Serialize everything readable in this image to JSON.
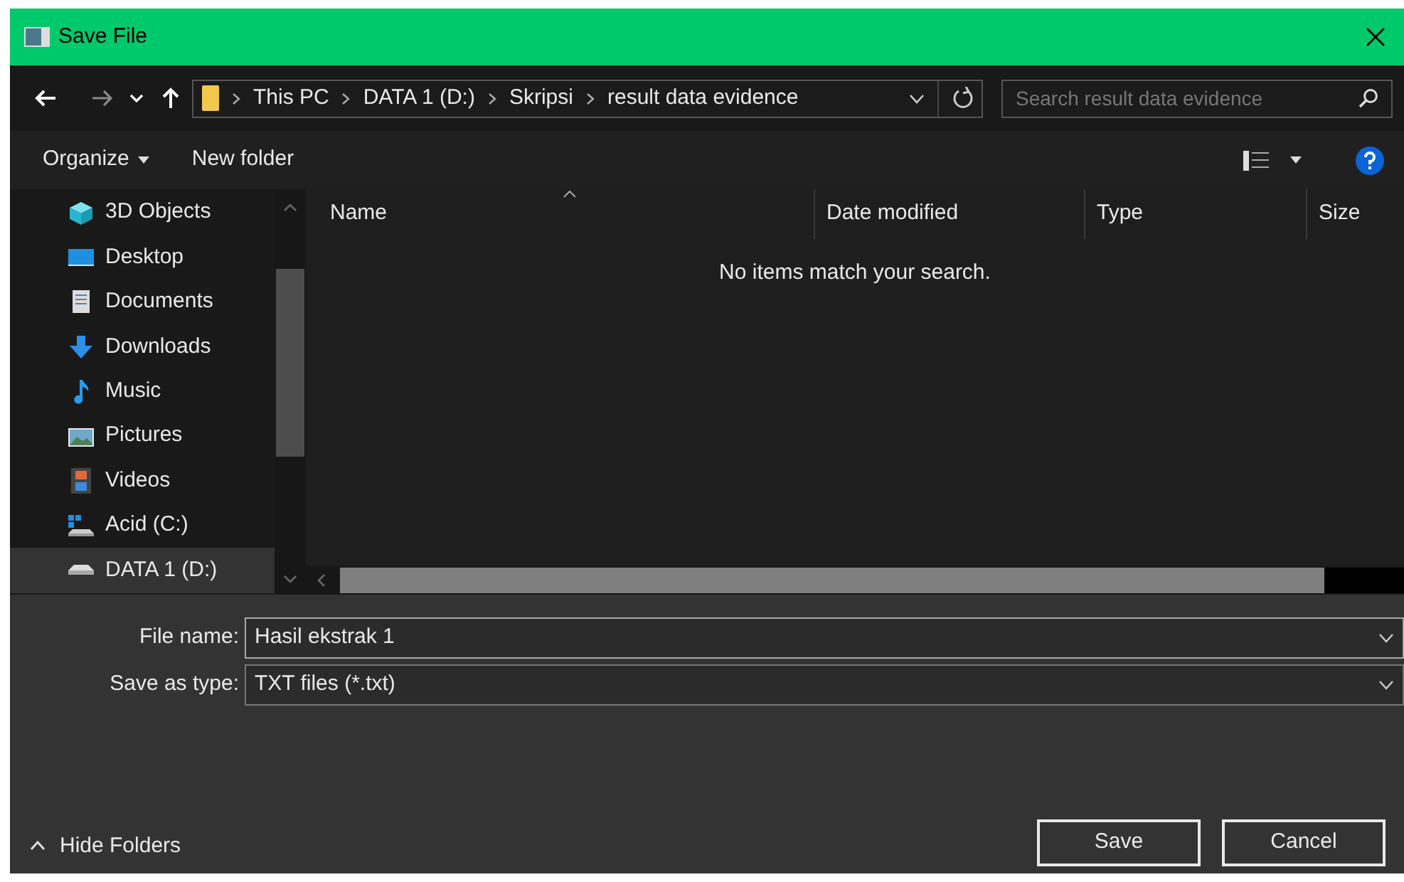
{
  "window": {
    "title": "Save File"
  },
  "address_bar": {
    "path": [
      "This PC",
      "DATA 1 (D:)",
      "Skripsi",
      "result data evidence"
    ]
  },
  "search": {
    "placeholder": "Search result data evidence"
  },
  "toolbar": {
    "organize": "Organize",
    "new_folder": "New folder"
  },
  "sidebar": {
    "items": [
      {
        "label": "3D Objects",
        "kind": "cube",
        "selected": false
      },
      {
        "label": "Desktop",
        "kind": "desktop",
        "selected": false
      },
      {
        "label": "Documents",
        "kind": "document",
        "selected": false
      },
      {
        "label": "Downloads",
        "kind": "download",
        "selected": false
      },
      {
        "label": "Music",
        "kind": "music",
        "selected": false
      },
      {
        "label": "Pictures",
        "kind": "pictures",
        "selected": false
      },
      {
        "label": "Videos",
        "kind": "videos",
        "selected": false
      },
      {
        "label": "Acid (C:)",
        "kind": "system-drive",
        "selected": false
      },
      {
        "label": "DATA 1 (D:)",
        "kind": "drive",
        "selected": true
      }
    ]
  },
  "file_list": {
    "columns": [
      "Name",
      "Date modified",
      "Type",
      "Size"
    ],
    "empty_message": "No items match your search."
  },
  "form": {
    "fields": [
      {
        "label": "File name:",
        "value": "Hasil ekstrak 1"
      },
      {
        "label": "Save as type:",
        "value": "TXT files (*.txt)"
      }
    ]
  },
  "footer": {
    "hide_folders": "Hide Folders",
    "buttons": [
      "Save",
      "Cancel"
    ]
  }
}
